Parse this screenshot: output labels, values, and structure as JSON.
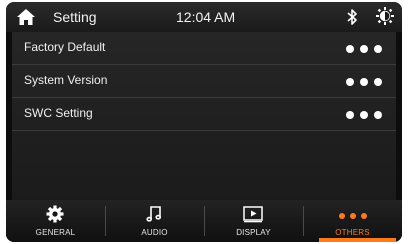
{
  "header": {
    "title": "Setting",
    "time": "12:04 AM",
    "home_icon": "home-icon",
    "bluetooth_icon": "bluetooth-icon",
    "brightness_icon": "brightness-icon"
  },
  "list": {
    "items": [
      {
        "label": "Factory Default",
        "action_icon": "more-dots-icon"
      },
      {
        "label": "System Version",
        "action_icon": "more-dots-icon"
      },
      {
        "label": "SWC Setting",
        "action_icon": "more-dots-icon"
      }
    ]
  },
  "nav": {
    "tabs": [
      {
        "label": "GENERAL",
        "icon": "gear-icon",
        "active": false
      },
      {
        "label": "AUDIO",
        "icon": "music-note-icon",
        "active": false
      },
      {
        "label": "DISPLAY",
        "icon": "play-screen-icon",
        "active": false
      },
      {
        "label": "OTHERS",
        "icon": "more-dots-icon",
        "active": true
      }
    ]
  },
  "colors": {
    "accent": "#ff7a1a",
    "background": "#0d0d0d",
    "text": "#f0f0f0"
  }
}
